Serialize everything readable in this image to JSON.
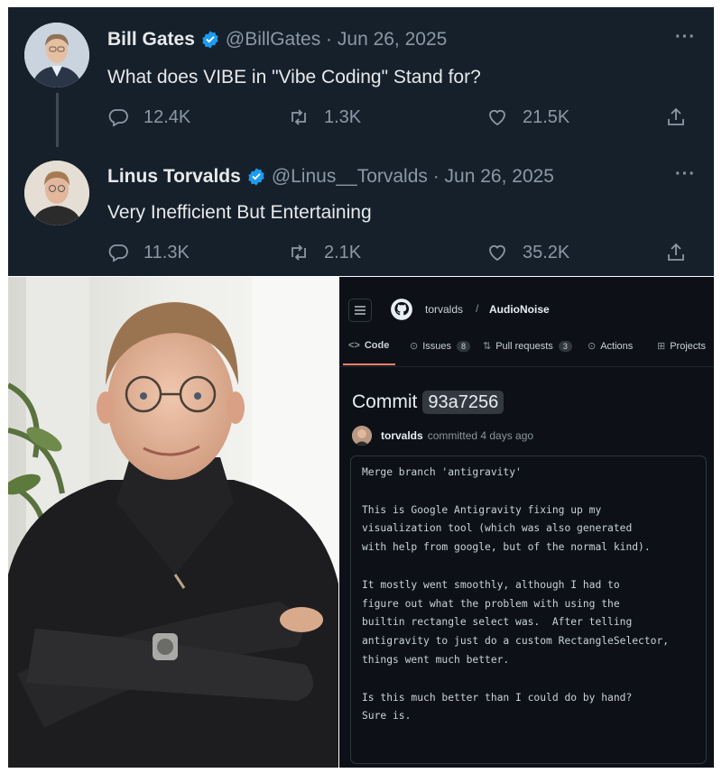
{
  "tweets": [
    {
      "name": "Bill Gates",
      "handle_date": "@BillGates · Jun 26, 2025",
      "more": "···",
      "text": "What does VIBE in \"Vibe Coding\" Stand for?",
      "replies": "12.4K",
      "retweets": "1.3K",
      "likes": "21.5K"
    },
    {
      "name": "Linus Torvalds",
      "handle_date": "@Linus__Torvalds · Jun 26, 2025",
      "more": "···",
      "text": "Very Inefficient But Entertaining",
      "replies": "11.3K",
      "retweets": "2.1K",
      "likes": "35.2K"
    }
  ],
  "colors": {
    "twitter_bg": "#15202b",
    "github_bg": "#0d1117",
    "verified_blue": "#1d9bf0"
  },
  "github": {
    "owner": "torvalds",
    "slash": "/",
    "repo": "AudioNoise",
    "tabs": {
      "code": "Code",
      "issues": "Issues",
      "issues_count": "8",
      "prs": "Pull requests",
      "prs_count": "3",
      "actions": "Actions",
      "projects": "Projects"
    },
    "commit_label": "Commit",
    "commit_sha": "93a7256",
    "author": "torvalds",
    "committed": "committed 4 days ago",
    "message": "Merge branch 'antigravity'\n\nThis is Google Antigravity fixing up my\nvisualization tool (which was also generated\nwith help from google, but of the normal kind).\n\nIt mostly went smoothly, although I had to\nfigure out what the problem with using the\nbuiltin rectangle select was.  After telling\nantigravity to just do a custom RectangleSelector,\nthings went much better.\n\nIs this much better than I could do by hand?\nSure is."
  }
}
